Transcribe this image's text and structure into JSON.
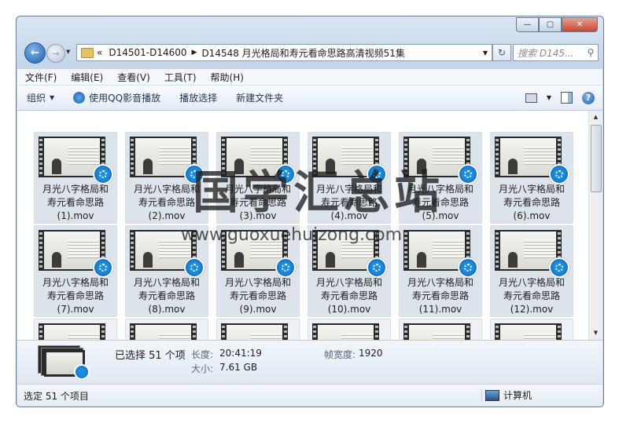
{
  "window": {
    "caption_buttons": [
      "minimize",
      "maximize",
      "close"
    ]
  },
  "address": {
    "chevron": "«",
    "crumbs": [
      "D14501-D14600",
      "D14548 月光格局和寿元看命思路高清视频51集"
    ],
    "search_placeholder": "搜索 D145..."
  },
  "menu": [
    "文件(F)",
    "编辑(E)",
    "查看(V)",
    "工具(T)",
    "帮助(H)"
  ],
  "toolbar": {
    "organize": "组织",
    "play_qq": "使用QQ影音播放",
    "play_selected": "播放选择",
    "new_folder": "新建文件夹"
  },
  "files": [
    {
      "name": "月光八字格局和寿元看命思路",
      "file": "(1).mov"
    },
    {
      "name": "月光八字格局和寿元看命思路",
      "file": "(2).mov"
    },
    {
      "name": "月光八字格局和寿元看命思路",
      "file": "(3).mov"
    },
    {
      "name": "月光八字格局和寿元看命思路",
      "file": "(4).mov"
    },
    {
      "name": "月光八字格局和寿元看命思路",
      "file": "(5).mov"
    },
    {
      "name": "月光八字格局和寿元看命思路",
      "file": "(6).mov"
    },
    {
      "name": "月光八字格局和寿元看命思路",
      "file": "(7).mov"
    },
    {
      "name": "月光八字格局和寿元看命思路",
      "file": "(8).mov"
    },
    {
      "name": "月光八字格局和寿元看命思路",
      "file": "(9).mov"
    },
    {
      "name": "月光八字格局和寿元看命思路",
      "file": "(10).mov"
    },
    {
      "name": "月光八字格局和寿元看命思路",
      "file": "(11).mov"
    },
    {
      "name": "月光八字格局和寿元看命思路",
      "file": "(12).mov"
    }
  ],
  "details": {
    "selected": "已选择 51 个项",
    "length_label": "长度:",
    "length_value": "20:41:19",
    "size_label": "大小:",
    "size_value": "7.61 GB",
    "width_label": "帧宽度:",
    "width_value": "1920"
  },
  "status": {
    "left": "选定 51 个项目",
    "right": "计算机"
  },
  "watermark": {
    "title": "国学汇总站",
    "url": "www.guoxuehuizong.com"
  }
}
